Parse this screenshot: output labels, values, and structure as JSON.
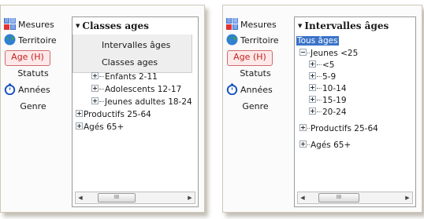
{
  "left": {
    "sidebar": [
      {
        "label": "Mesures",
        "icon": "grid-chart-icon"
      },
      {
        "label": "Territoire",
        "icon": "globe-icon"
      },
      {
        "label": "Age (H)",
        "active": true
      },
      {
        "label": "Statuts"
      },
      {
        "label": "Années",
        "icon": "stopwatch-icon"
      },
      {
        "label": "Genre"
      }
    ],
    "combo_label": "Classes ages",
    "dropdown_options": [
      "Intervalles âges",
      "Classes ages"
    ],
    "tree": [
      "Enfants 2-11",
      "Adolescents 12-17",
      "Jeunes adultes 18-24",
      "Productifs 25-64",
      "Agés 65+"
    ],
    "scroll_thumb": "III"
  },
  "right": {
    "sidebar": [
      {
        "label": "Mesures",
        "icon": "grid-chart-icon"
      },
      {
        "label": "Territoire",
        "icon": "globe-icon"
      },
      {
        "label": "Age (H)",
        "active": true
      },
      {
        "label": "Statuts"
      },
      {
        "label": "Années",
        "icon": "stopwatch-icon"
      },
      {
        "label": "Genre"
      }
    ],
    "combo_label": "Intervalles âges",
    "tree_root": "Tous âges",
    "tree_group": "Jeunes <25",
    "tree_children": [
      "<5",
      "5-9",
      "10-14",
      "15-19",
      "20-24"
    ],
    "tree_rest": [
      "Productifs 25-64",
      "Agés 65+"
    ],
    "scroll_thumb": "III"
  },
  "colors": {
    "active_red": "#c62020",
    "selection_blue": "#3a73c8"
  }
}
